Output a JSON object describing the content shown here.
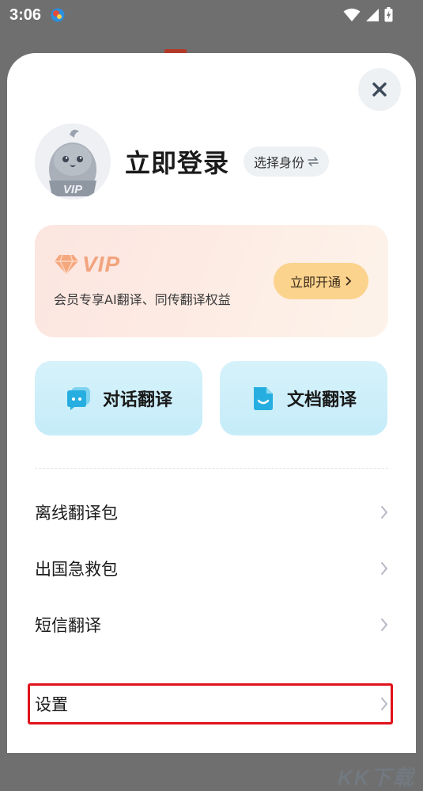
{
  "status_bar": {
    "time": "3:06",
    "icons": [
      "app-notification-icon",
      "wifi-icon",
      "signal-icon",
      "battery-icon"
    ]
  },
  "header": {
    "login_title": "立即登录",
    "identity_chip": "选择身份",
    "identity_chip_icon": "swap-icon",
    "avatar_badge": "VIP"
  },
  "vip_card": {
    "logo_text": "VIP",
    "description": "会员专享AI翻译、同传翻译权益",
    "button_label": "立即开通",
    "accent": "#f2a47e",
    "button_color": "#fbd38d"
  },
  "features": [
    {
      "label": "对话翻译",
      "icon": "chat-bubble-icon"
    },
    {
      "label": "文档翻译",
      "icon": "document-icon"
    }
  ],
  "menu": [
    {
      "label": "离线翻译包"
    },
    {
      "label": "出国急救包"
    },
    {
      "label": "短信翻译"
    },
    {
      "label": "设置"
    }
  ],
  "highlight_color": "#e0121b",
  "watermark": "KK下载"
}
